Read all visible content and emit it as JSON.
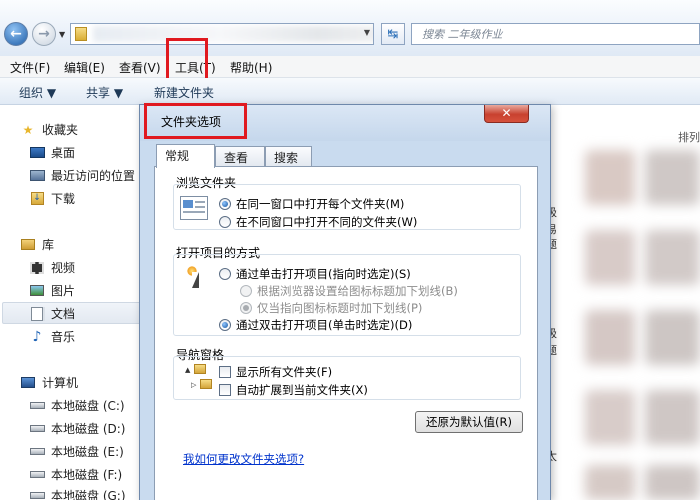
{
  "search": {
    "placeholder": "搜索 二年级作业"
  },
  "menu": [
    "文件(F)",
    "编辑(E)",
    "查看(V)",
    "工具(T)",
    "帮助(H)"
  ],
  "command_bar": [
    "组织 ▼",
    "共享 ▼",
    "新建文件夹"
  ],
  "nav": {
    "favorites": "收藏夹",
    "desktop": "桌面",
    "recent": "最近访问的位置",
    "downloads": "下载",
    "libraries": "库",
    "videos": "视频",
    "pictures": "图片",
    "documents": "文档",
    "music": "音乐",
    "computer": "计算机",
    "drives": [
      "本地磁盘 (C:)",
      "本地磁盘 (D:)",
      "本地磁盘 (E:)",
      "本地磁盘 (F:)",
      "本地磁盘 (G:)"
    ]
  },
  "content": {
    "sort_label": "排列",
    "side_chars": [
      "极",
      "易",
      "题",
      "极",
      "题",
      "太"
    ]
  },
  "dialog": {
    "title": "文件夹选项",
    "close": "✕",
    "tabs": [
      "常规",
      "查看",
      "搜索"
    ],
    "browse_group": {
      "title": "浏览文件夹",
      "options": [
        "在同一窗口中打开每个文件夹(M)",
        "在不同窗口中打开不同的文件夹(W)"
      ],
      "selected_index": 0
    },
    "click_group": {
      "title": "打开项目的方式",
      "single_click": "通过单击打开项目(指向时选定)(S)",
      "underline_browser": "根据浏览器设置给图标标题加下划线(B)",
      "underline_hover": "仅当指向图标标题时加下划线(P)",
      "double_click": "通过双击打开项目(单击时选定)(D)",
      "selected": "double_click"
    },
    "nav_group": {
      "title": "导航窗格",
      "show_all": "显示所有文件夹(F)",
      "show_all_checked": false,
      "auto_expand": "自动扩展到当前文件夹(X)",
      "auto_expand_checked": false
    },
    "restore_button": "还原为默认值(R)",
    "help_link": "我如何更改文件夹选项?"
  },
  "colors": {
    "highlight_red": "#e0191f",
    "link_blue": "#0033cc"
  },
  "icons": [
    "back-arrow-icon",
    "forward-arrow-icon",
    "refresh-icon",
    "search-icon",
    "star-icon",
    "desktop-icon",
    "recent-places-icon",
    "downloads-icon",
    "library-icon",
    "video-icon",
    "pictures-icon",
    "documents-icon",
    "music-icon",
    "computer-icon",
    "drive-icon",
    "folder-window-icon",
    "click-pointer-icon",
    "folder-tree-icon"
  ]
}
